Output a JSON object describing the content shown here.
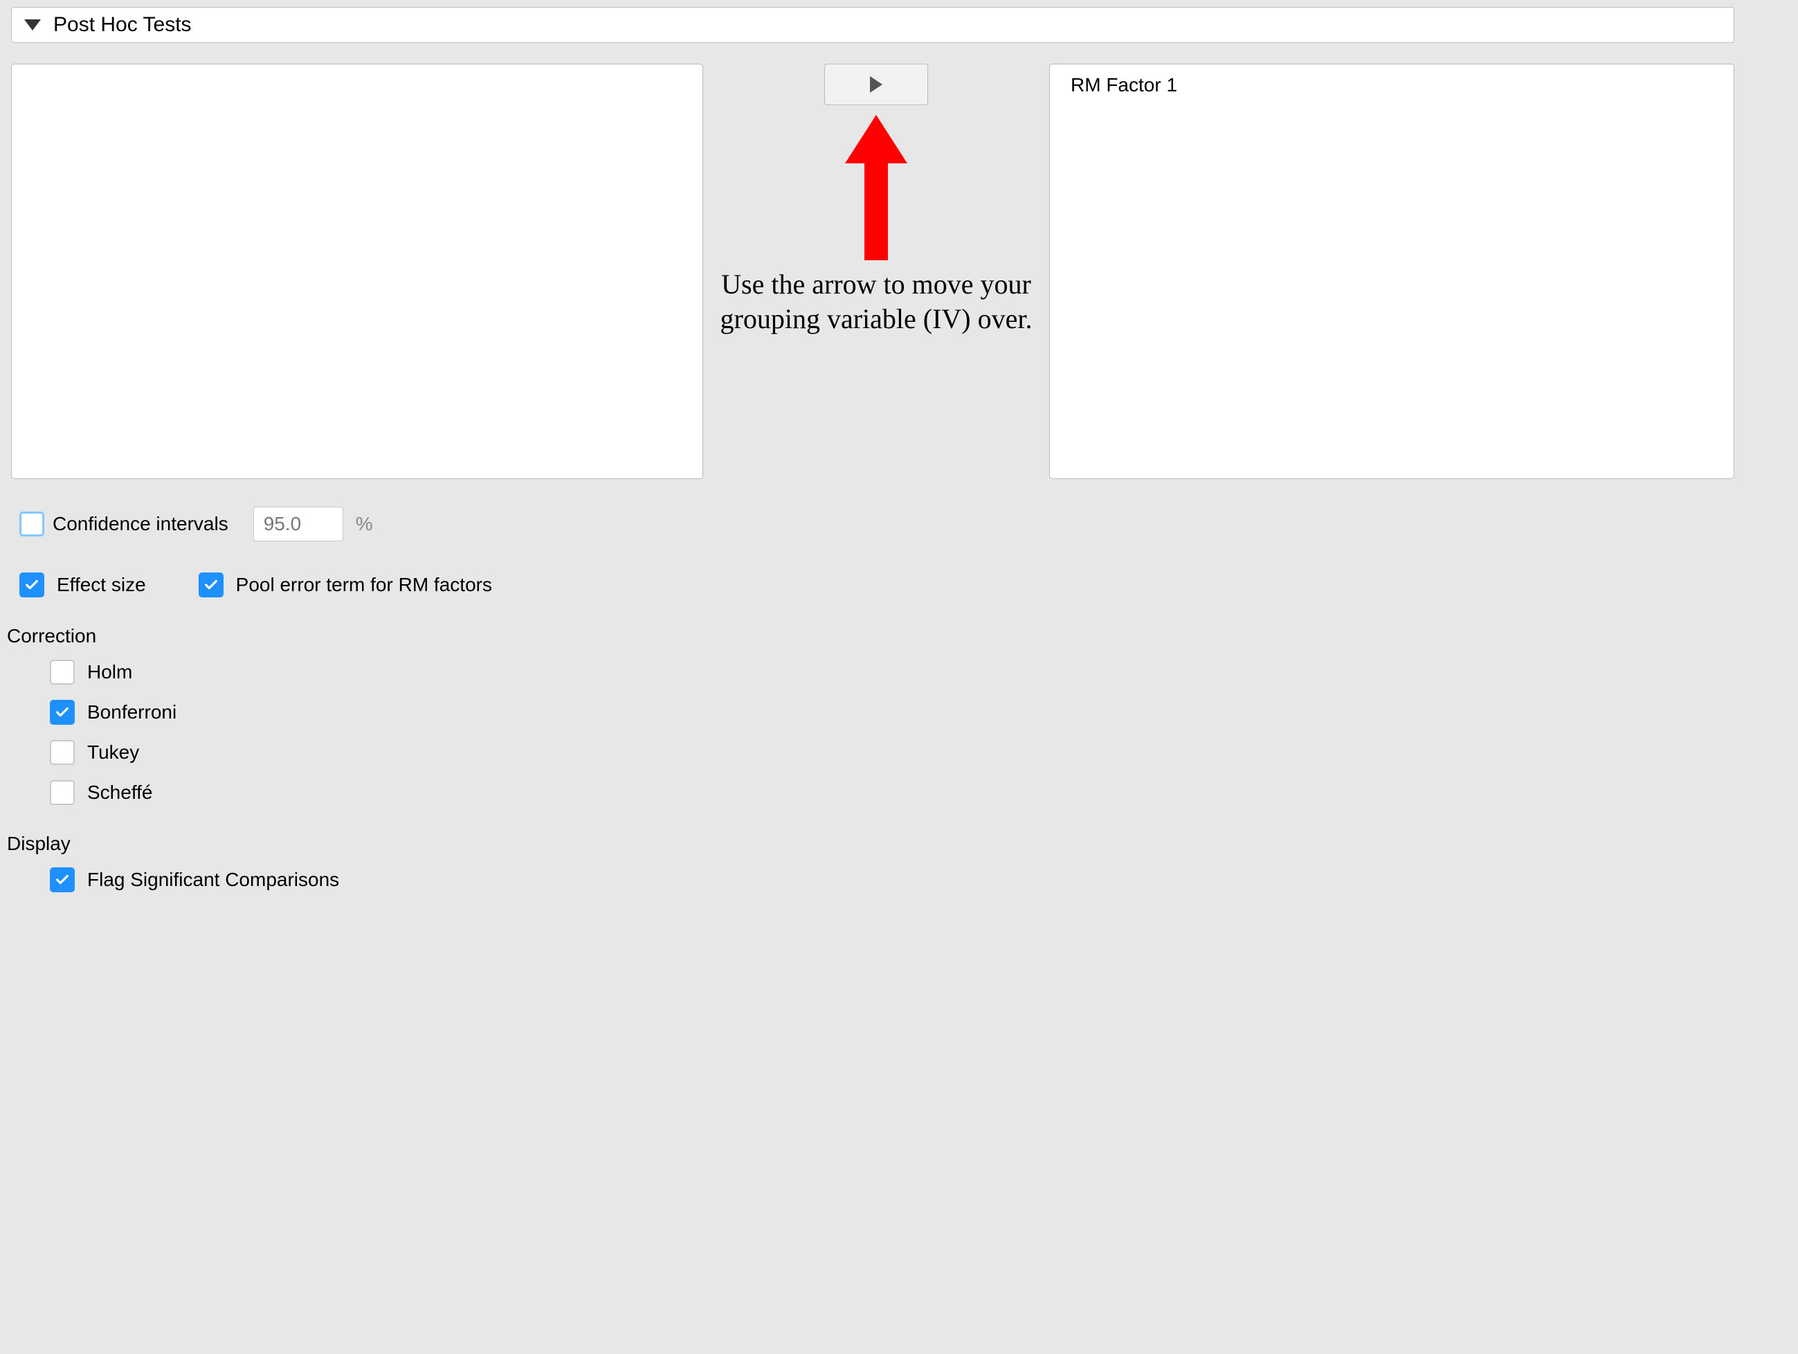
{
  "panel": {
    "title": "Post Hoc Tests"
  },
  "transfer": {
    "right_item": "RM Factor 1",
    "annotation": "Use the arrow to move your grouping variable (IV) over."
  },
  "options": {
    "confidence_intervals": {
      "label": "Confidence intervals",
      "value": "95.0",
      "pct": "%"
    },
    "effect_size": {
      "label": "Effect size"
    },
    "pool_error": {
      "label": "Pool error term for RM factors"
    }
  },
  "correction": {
    "heading": "Correction",
    "holm": "Holm",
    "bonferroni": "Bonferroni",
    "tukey": "Tukey",
    "scheffe": "Scheffé"
  },
  "display": {
    "heading": "Display",
    "flag": "Flag Significant Comparisons"
  }
}
